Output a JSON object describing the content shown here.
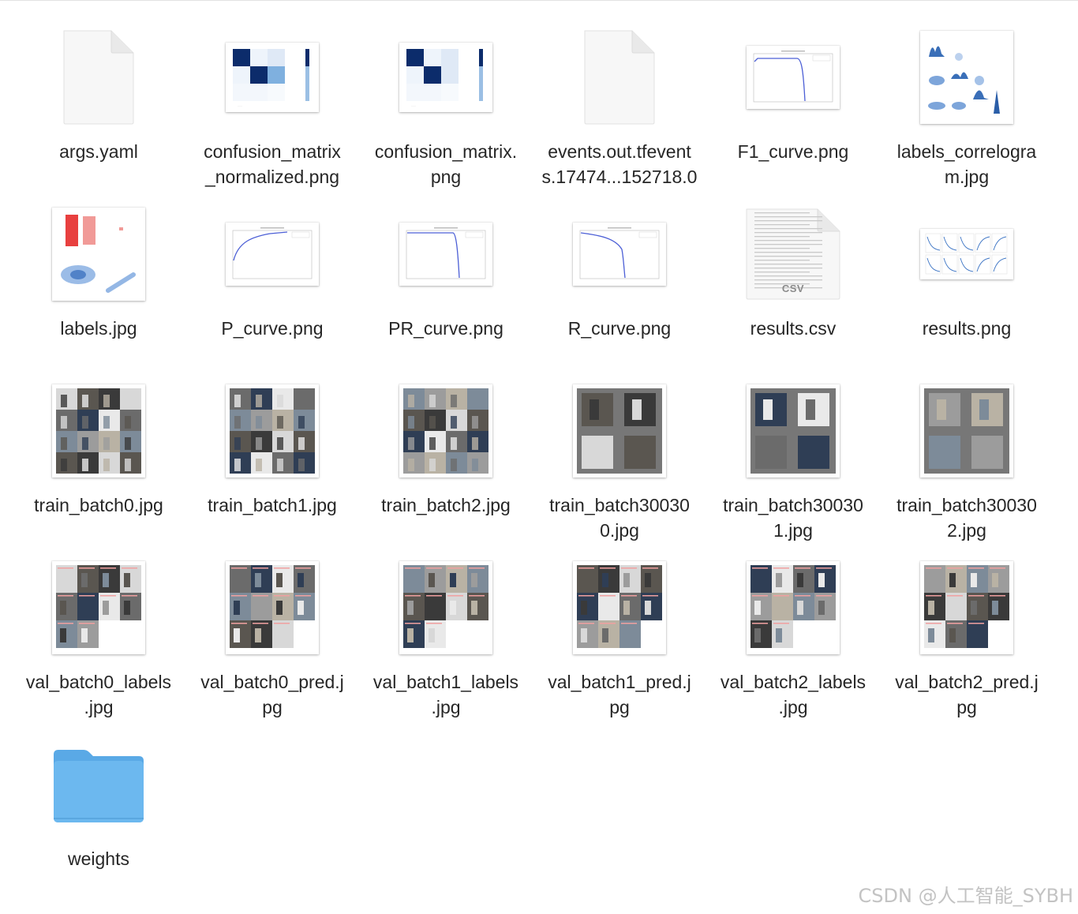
{
  "files": [
    {
      "name": "args.yaml",
      "kind": "document",
      "icon": "yaml-file-icon"
    },
    {
      "name": "confusion_matrix\n_normalized.png",
      "kind": "matrix",
      "icon": "png-thumbnail-icon"
    },
    {
      "name": "confusion_matrix.\npng",
      "kind": "matrix",
      "icon": "png-thumbnail-icon"
    },
    {
      "name": "events.out.tfevent\ns.17474...152718.0",
      "kind": "document",
      "icon": "tfevents-file-icon"
    },
    {
      "name": "F1_curve.png",
      "kind": "curve-f1",
      "icon": "png-thumbnail-icon"
    },
    {
      "name": "labels_correlogra\nm.jpg",
      "kind": "correlogram",
      "icon": "jpg-thumbnail-icon"
    },
    {
      "name": "labels.jpg",
      "kind": "labels",
      "icon": "jpg-thumbnail-icon"
    },
    {
      "name": "P_curve.png",
      "kind": "curve-p",
      "icon": "png-thumbnail-icon"
    },
    {
      "name": "PR_curve.png",
      "kind": "curve-pr",
      "icon": "png-thumbnail-icon"
    },
    {
      "name": "R_curve.png",
      "kind": "curve-r",
      "icon": "png-thumbnail-icon"
    },
    {
      "name": "results.csv",
      "kind": "csv",
      "icon": "csv-file-icon",
      "badge": "CSV"
    },
    {
      "name": "results.png",
      "kind": "results",
      "icon": "png-thumbnail-icon"
    },
    {
      "name": "train_batch0.jpg",
      "kind": "photo-grid",
      "icon": "jpg-thumbnail-icon"
    },
    {
      "name": "train_batch1.jpg",
      "kind": "photo-grid",
      "icon": "jpg-thumbnail-icon"
    },
    {
      "name": "train_batch2.jpg",
      "kind": "photo-grid",
      "icon": "jpg-thumbnail-icon"
    },
    {
      "name": "train_batch30030\n0.jpg",
      "kind": "photo-quad",
      "icon": "jpg-thumbnail-icon"
    },
    {
      "name": "train_batch30030\n1.jpg",
      "kind": "photo-quad",
      "icon": "jpg-thumbnail-icon"
    },
    {
      "name": "train_batch30030\n2.jpg",
      "kind": "photo-quad",
      "icon": "jpg-thumbnail-icon"
    },
    {
      "name": "val_batch0_labels\n.jpg",
      "kind": "val-grid",
      "icon": "jpg-thumbnail-icon"
    },
    {
      "name": "val_batch0_pred.j\npg",
      "kind": "val-grid",
      "icon": "jpg-thumbnail-icon"
    },
    {
      "name": "val_batch1_labels\n.jpg",
      "kind": "val-grid",
      "icon": "jpg-thumbnail-icon"
    },
    {
      "name": "val_batch1_pred.j\npg",
      "kind": "val-grid",
      "icon": "jpg-thumbnail-icon"
    },
    {
      "name": "val_batch2_labels\n.jpg",
      "kind": "val-grid",
      "icon": "jpg-thumbnail-icon"
    },
    {
      "name": "val_batch2_pred.j\npg",
      "kind": "val-grid",
      "icon": "jpg-thumbnail-icon"
    },
    {
      "name": "weights",
      "kind": "folder",
      "icon": "folder-icon"
    }
  ],
  "colors": {
    "folder": "#6cb8ef",
    "matrix_dark": "#0c2c6b",
    "curve_line": "#4c5fd6",
    "label_bar": "#e8403f"
  },
  "watermark": "CSDN @人工智能_SYBH"
}
